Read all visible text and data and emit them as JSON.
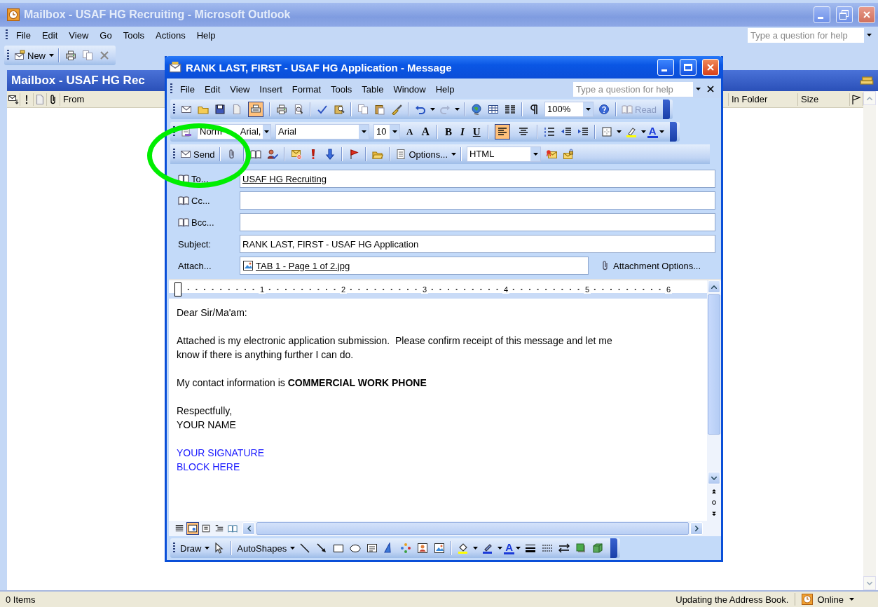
{
  "window": {
    "title": "Mailbox - USAF HG Recruiting - Microsoft Outlook"
  },
  "menu": [
    "File",
    "Edit",
    "View",
    "Go",
    "Tools",
    "Actions",
    "Help"
  ],
  "help": {
    "placeholder": "Type a question for help"
  },
  "toolbar": [
    [
      {
        "kind": "new",
        "label": "New"
      },
      {
        "kind": "caret"
      }
    ],
    [
      {
        "kind": "printer"
      },
      {
        "kind": "copy"
      },
      {
        "kind": "delete"
      }
    ]
  ],
  "folder": {
    "title": "Mailbox - USAF HG Rec"
  },
  "columns": {
    "from": "From",
    "in_folder": "In Folder",
    "size": "Size"
  },
  "message": {
    "title": "RANK LAST, FIRST - USAF HG Application - Message",
    "menu": [
      "File",
      "Edit",
      "View",
      "Insert",
      "Format",
      "Tools",
      "Table",
      "Window",
      "Help"
    ],
    "help": {
      "placeholder": "Type a question for help"
    },
    "standard": [
      [
        {
          "kind": "envelope"
        },
        {
          "kind": "folder"
        },
        {
          "kind": "disk"
        },
        {
          "kind": "page"
        },
        {
          "kind": "mail-printer",
          "on": true
        }
      ],
      [
        {
          "kind": "printer"
        },
        {
          "kind": "preview"
        }
      ],
      [
        {
          "kind": "checkmark"
        },
        {
          "kind": "research"
        }
      ],
      [
        {
          "kind": "copy"
        },
        {
          "kind": "paste"
        },
        {
          "kind": "brush"
        }
      ],
      [
        {
          "kind": "undo"
        },
        {
          "kind": "caret"
        },
        {
          "kind": "redo"
        },
        {
          "kind": "caret"
        }
      ],
      [
        {
          "kind": "globe"
        },
        {
          "kind": "table"
        },
        {
          "kind": "columns"
        }
      ],
      [
        {
          "kind": "pilcrow"
        },
        {
          "kind": "zoom-box",
          "value": "100%"
        },
        {
          "kind": "help"
        }
      ],
      [
        {
          "kind": "read",
          "label": "Read",
          "disabled": true
        }
      ]
    ],
    "formatting": [
      [
        {
          "kind": "styles"
        },
        {
          "kind": "style-box",
          "value": "Norm",
          "value_tail": "Arial,"
        },
        {
          "kind": "font-box",
          "value": "Arial"
        },
        {
          "kind": "size-box",
          "value": "10"
        },
        {
          "kind": "grow-font",
          "label": "A"
        },
        {
          "kind": "shrink-font",
          "label": "A"
        }
      ],
      [
        {
          "kind": "bold",
          "label": "B"
        },
        {
          "kind": "italic",
          "label": "I"
        },
        {
          "kind": "underline",
          "label": "U"
        }
      ],
      [
        {
          "kind": "align-left",
          "selected": true
        },
        {
          "kind": "align-center",
          "selected": false
        }
      ],
      [
        {
          "kind": "numbering"
        },
        {
          "kind": "outdent"
        },
        {
          "kind": "indent"
        }
      ],
      [
        {
          "kind": "border"
        },
        {
          "kind": "caret"
        },
        {
          "kind": "highlighter"
        },
        {
          "kind": "caret"
        },
        {
          "kind": "font-color",
          "label": "A"
        },
        {
          "kind": "caret"
        }
      ]
    ],
    "email": [
      [
        {
          "kind": "send",
          "label": "Send"
        }
      ],
      [
        {
          "kind": "paperclip"
        }
      ],
      [
        {
          "kind": "book"
        },
        {
          "kind": "person-check"
        }
      ],
      [
        {
          "kind": "mail-block"
        },
        {
          "kind": "exclaim"
        },
        {
          "kind": "down-arrow"
        }
      ],
      [
        {
          "kind": "flag"
        }
      ],
      [
        {
          "kind": "folder-open"
        }
      ],
      [
        {
          "kind": "options",
          "label": "Options..."
        },
        {
          "kind": "caret"
        }
      ],
      [
        {
          "kind": "format-box",
          "value": "HTML"
        },
        {
          "kind": "mail-ribbon"
        },
        {
          "kind": "mail-lock"
        }
      ]
    ],
    "fields": [
      {
        "label": "To...",
        "kind": "address",
        "value": "USAF HG Recruiting"
      },
      {
        "label": "Cc...",
        "kind": "address"
      },
      {
        "label": "Bcc...",
        "kind": "address"
      },
      {
        "label": "Subject:",
        "kind": "text",
        "value": "RANK LAST, FIRST - USAF HG Application"
      }
    ],
    "attach": {
      "label": "Attach...",
      "file": "TAB 1 - Page 1 of 2.jpg",
      "options": "Attachment Options..."
    },
    "ruler": [
      "1",
      "2",
      "3",
      "4",
      "5",
      "6"
    ],
    "body": [
      {
        "kind": "para",
        "text": "Dear Sir/Ma'am:"
      },
      {
        "kind": "para",
        "text": "Attached is my electronic application submission.  Please confirm receipt of this message and let me know if there is anything further I can do."
      },
      {
        "kind": "para",
        "text": "My contact information is **COMMERCIAL WORK PHONE**"
      },
      {
        "kind": "lines",
        "lines": [
          "Respectfully,",
          "YOUR NAME"
        ]
      },
      {
        "kind": "signature",
        "lines": [
          "YOUR SIGNATURE",
          "BLOCK HERE"
        ]
      }
    ],
    "views": [
      {
        "kind": "view-normal",
        "selected": false
      },
      {
        "kind": "view-web",
        "selected": true
      },
      {
        "kind": "view-print",
        "selected": false
      },
      {
        "kind": "view-outline",
        "selected": false
      },
      {
        "kind": "view-reading",
        "selected": false
      }
    ],
    "draw": [
      [
        {
          "kind": "draw",
          "label": "Draw"
        },
        {
          "kind": "caret"
        },
        {
          "kind": "pointer"
        }
      ],
      [
        {
          "kind": "autoshapes",
          "label": "AutoShapes"
        },
        {
          "kind": "caret"
        },
        {
          "kind": "line"
        },
        {
          "kind": "arrow"
        },
        {
          "kind": "rectangle"
        },
        {
          "kind": "oval"
        },
        {
          "kind": "textbox"
        },
        {
          "kind": "wordart"
        },
        {
          "kind": "diagram"
        },
        {
          "kind": "clipart"
        },
        {
          "kind": "picture-frame"
        }
      ],
      [
        {
          "kind": "bucket"
        },
        {
          "kind": "caret"
        },
        {
          "kind": "pen"
        },
        {
          "kind": "caret"
        },
        {
          "kind": "font-color",
          "label": "A"
        },
        {
          "kind": "caret"
        },
        {
          "kind": "line-style"
        },
        {
          "kind": "dash-style"
        },
        {
          "kind": "arrow-style"
        },
        {
          "kind": "shadow"
        },
        {
          "kind": "cube"
        }
      ]
    ]
  },
  "status_bar": {
    "count": "0 Items",
    "message": "Updating the Address Book.",
    "connection": "Online"
  }
}
